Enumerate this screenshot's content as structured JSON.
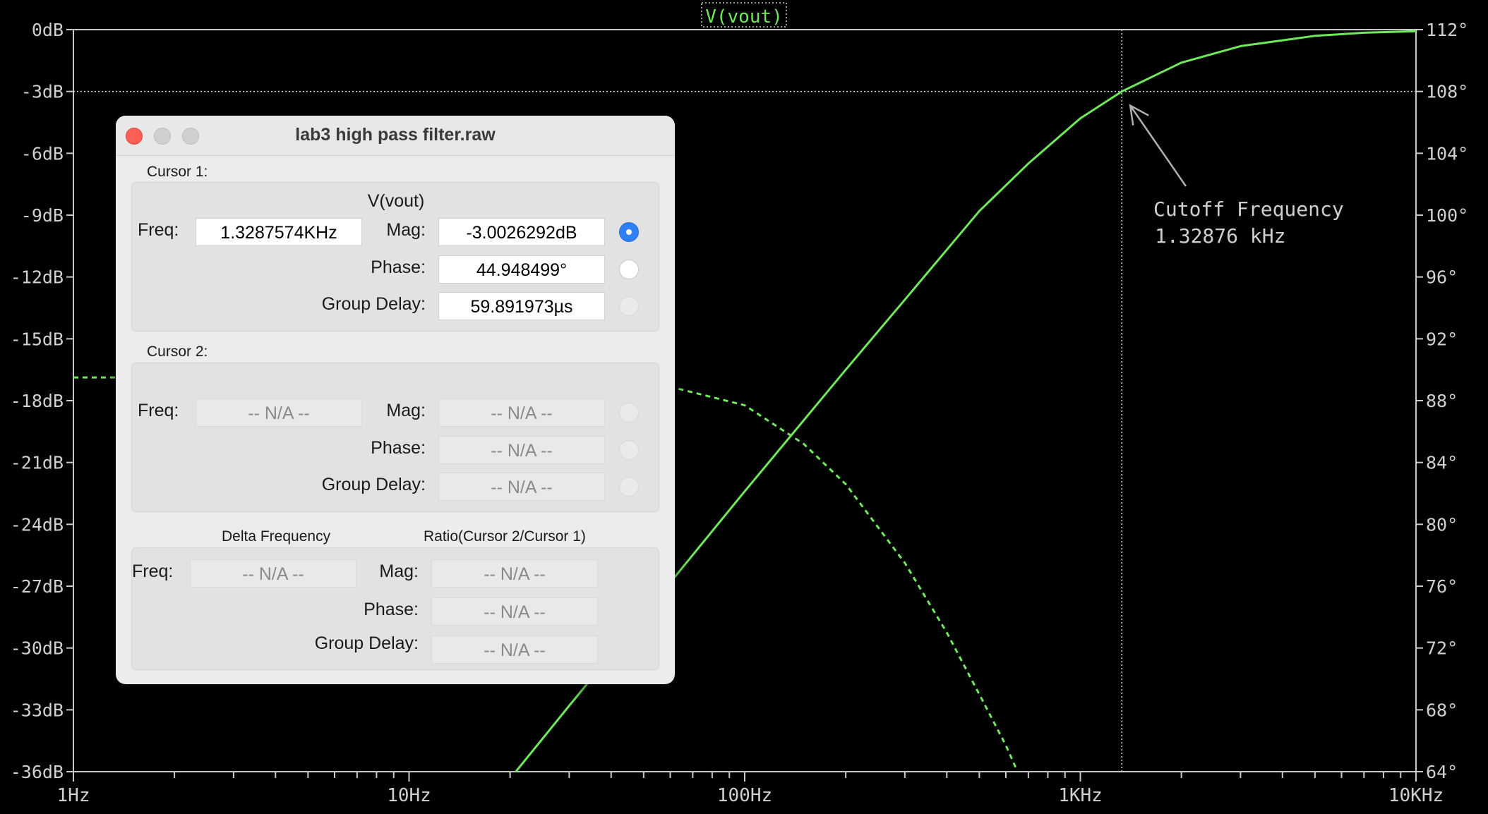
{
  "plot": {
    "trace_label": "V(vout)",
    "left_axis_labels": [
      "0dB",
      "-3dB",
      "-6dB",
      "-9dB",
      "-12dB",
      "-15dB",
      "-18dB",
      "-21dB",
      "-24dB",
      "-27dB",
      "-30dB",
      "-33dB",
      "-36dB"
    ],
    "right_axis_labels": [
      "112°",
      "108°",
      "104°",
      "100°",
      "96°",
      "92°",
      "88°",
      "84°",
      "80°",
      "76°",
      "72°",
      "68°",
      "64°"
    ],
    "x_axis_labels": [
      "1Hz",
      "10Hz",
      "100Hz",
      "1KHz",
      "10KHz"
    ],
    "annotation_line1": "Cutoff Frequency",
    "annotation_line2": "1.32876 kHz",
    "trace_color": "#6fe85a",
    "cursor_color": "#d8d8d8"
  },
  "chart_data": {
    "type": "line",
    "title": "V(vout)",
    "xscale": "log",
    "xlim": [
      1,
      10000
    ],
    "ylim_left_db": [
      -36,
      0
    ],
    "ylim_right_deg": [
      64,
      112
    ],
    "cursor": {
      "freq_hz": 1328.7574,
      "mag_db": -3.0
    },
    "series": [
      {
        "style": "solid",
        "axis": "left",
        "x": [
          20.8,
          30,
          50,
          100,
          200,
          300,
          500,
          700,
          1000,
          1328.76,
          2000,
          3000,
          5000,
          7000,
          10000
        ],
        "y": [
          -36,
          -32.8,
          -28.4,
          -22.4,
          -16.5,
          -13.1,
          -8.8,
          -6.5,
          -4.3,
          -3.0,
          -1.6,
          -0.8,
          -0.3,
          -0.15,
          -0.08
        ]
      },
      {
        "style": "dashed",
        "axis": "right",
        "x": [
          1,
          3.5,
          60,
          100,
          150,
          200,
          300,
          400,
          500,
          600,
          650
        ],
        "y": [
          89.5,
          89.5,
          88.9,
          87.7,
          85.2,
          82.6,
          77.5,
          73.0,
          69.0,
          65.7,
          64.0
        ]
      }
    ]
  },
  "dialog": {
    "title": "lab3 high pass filter.raw",
    "cursor1": {
      "section": "Cursor 1:",
      "trace": "V(vout)",
      "freq_label": "Freq:",
      "freq": "1.3287574KHz",
      "mag_label": "Mag:",
      "mag": "-3.0026292dB",
      "phase_label": "Phase:",
      "phase": "44.948499°",
      "gd_label": "Group Delay:",
      "gd": "59.891973µs"
    },
    "cursor2": {
      "section": "Cursor 2:",
      "freq_label": "Freq:",
      "freq": "-- N/A --",
      "mag_label": "Mag:",
      "mag": "-- N/A --",
      "phase_label": "Phase:",
      "phase": "-- N/A --",
      "gd_label": "Group Delay:",
      "gd": "-- N/A --"
    },
    "delta": {
      "delta_header": "Delta Frequency",
      "ratio_header": "Ratio(Cursor 2/Cursor 1)",
      "freq_label": "Freq:",
      "freq": "-- N/A --",
      "mag_label": "Mag:",
      "mag": "-- N/A --",
      "phase_label": "Phase:",
      "phase": "-- N/A --",
      "gd_label": "Group Delay:",
      "gd": "-- N/A --"
    }
  }
}
